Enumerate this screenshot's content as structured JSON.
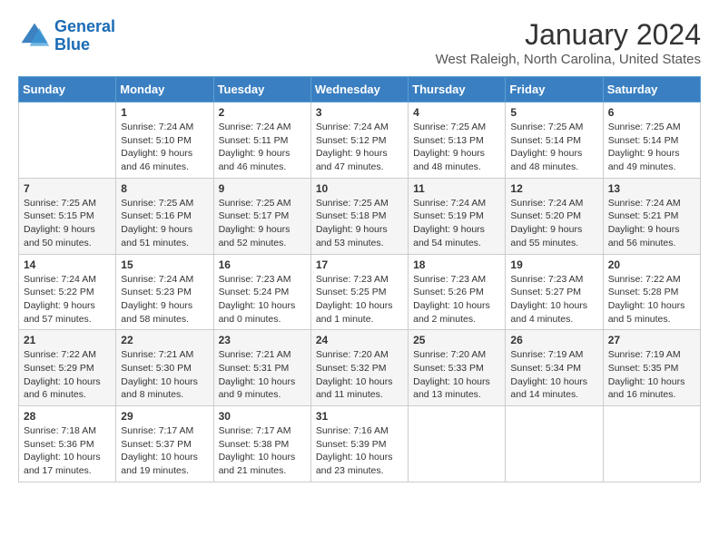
{
  "logo": {
    "text_general": "General",
    "text_blue": "Blue"
  },
  "title": "January 2024",
  "subtitle": "West Raleigh, North Carolina, United States",
  "days_of_week": [
    "Sunday",
    "Monday",
    "Tuesday",
    "Wednesday",
    "Thursday",
    "Friday",
    "Saturday"
  ],
  "weeks": [
    [
      {
        "day": "",
        "sunrise": "",
        "sunset": "",
        "daylight": ""
      },
      {
        "day": "1",
        "sunrise": "Sunrise: 7:24 AM",
        "sunset": "Sunset: 5:10 PM",
        "daylight": "Daylight: 9 hours and 46 minutes."
      },
      {
        "day": "2",
        "sunrise": "Sunrise: 7:24 AM",
        "sunset": "Sunset: 5:11 PM",
        "daylight": "Daylight: 9 hours and 46 minutes."
      },
      {
        "day": "3",
        "sunrise": "Sunrise: 7:24 AM",
        "sunset": "Sunset: 5:12 PM",
        "daylight": "Daylight: 9 hours and 47 minutes."
      },
      {
        "day": "4",
        "sunrise": "Sunrise: 7:25 AM",
        "sunset": "Sunset: 5:13 PM",
        "daylight": "Daylight: 9 hours and 48 minutes."
      },
      {
        "day": "5",
        "sunrise": "Sunrise: 7:25 AM",
        "sunset": "Sunset: 5:14 PM",
        "daylight": "Daylight: 9 hours and 48 minutes."
      },
      {
        "day": "6",
        "sunrise": "Sunrise: 7:25 AM",
        "sunset": "Sunset: 5:14 PM",
        "daylight": "Daylight: 9 hours and 49 minutes."
      }
    ],
    [
      {
        "day": "7",
        "sunrise": "Sunrise: 7:25 AM",
        "sunset": "Sunset: 5:15 PM",
        "daylight": "Daylight: 9 hours and 50 minutes."
      },
      {
        "day": "8",
        "sunrise": "Sunrise: 7:25 AM",
        "sunset": "Sunset: 5:16 PM",
        "daylight": "Daylight: 9 hours and 51 minutes."
      },
      {
        "day": "9",
        "sunrise": "Sunrise: 7:25 AM",
        "sunset": "Sunset: 5:17 PM",
        "daylight": "Daylight: 9 hours and 52 minutes."
      },
      {
        "day": "10",
        "sunrise": "Sunrise: 7:25 AM",
        "sunset": "Sunset: 5:18 PM",
        "daylight": "Daylight: 9 hours and 53 minutes."
      },
      {
        "day": "11",
        "sunrise": "Sunrise: 7:24 AM",
        "sunset": "Sunset: 5:19 PM",
        "daylight": "Daylight: 9 hours and 54 minutes."
      },
      {
        "day": "12",
        "sunrise": "Sunrise: 7:24 AM",
        "sunset": "Sunset: 5:20 PM",
        "daylight": "Daylight: 9 hours and 55 minutes."
      },
      {
        "day": "13",
        "sunrise": "Sunrise: 7:24 AM",
        "sunset": "Sunset: 5:21 PM",
        "daylight": "Daylight: 9 hours and 56 minutes."
      }
    ],
    [
      {
        "day": "14",
        "sunrise": "Sunrise: 7:24 AM",
        "sunset": "Sunset: 5:22 PM",
        "daylight": "Daylight: 9 hours and 57 minutes."
      },
      {
        "day": "15",
        "sunrise": "Sunrise: 7:24 AM",
        "sunset": "Sunset: 5:23 PM",
        "daylight": "Daylight: 9 hours and 58 minutes."
      },
      {
        "day": "16",
        "sunrise": "Sunrise: 7:23 AM",
        "sunset": "Sunset: 5:24 PM",
        "daylight": "Daylight: 10 hours and 0 minutes."
      },
      {
        "day": "17",
        "sunrise": "Sunrise: 7:23 AM",
        "sunset": "Sunset: 5:25 PM",
        "daylight": "Daylight: 10 hours and 1 minute."
      },
      {
        "day": "18",
        "sunrise": "Sunrise: 7:23 AM",
        "sunset": "Sunset: 5:26 PM",
        "daylight": "Daylight: 10 hours and 2 minutes."
      },
      {
        "day": "19",
        "sunrise": "Sunrise: 7:23 AM",
        "sunset": "Sunset: 5:27 PM",
        "daylight": "Daylight: 10 hours and 4 minutes."
      },
      {
        "day": "20",
        "sunrise": "Sunrise: 7:22 AM",
        "sunset": "Sunset: 5:28 PM",
        "daylight": "Daylight: 10 hours and 5 minutes."
      }
    ],
    [
      {
        "day": "21",
        "sunrise": "Sunrise: 7:22 AM",
        "sunset": "Sunset: 5:29 PM",
        "daylight": "Daylight: 10 hours and 6 minutes."
      },
      {
        "day": "22",
        "sunrise": "Sunrise: 7:21 AM",
        "sunset": "Sunset: 5:30 PM",
        "daylight": "Daylight: 10 hours and 8 minutes."
      },
      {
        "day": "23",
        "sunrise": "Sunrise: 7:21 AM",
        "sunset": "Sunset: 5:31 PM",
        "daylight": "Daylight: 10 hours and 9 minutes."
      },
      {
        "day": "24",
        "sunrise": "Sunrise: 7:20 AM",
        "sunset": "Sunset: 5:32 PM",
        "daylight": "Daylight: 10 hours and 11 minutes."
      },
      {
        "day": "25",
        "sunrise": "Sunrise: 7:20 AM",
        "sunset": "Sunset: 5:33 PM",
        "daylight": "Daylight: 10 hours and 13 minutes."
      },
      {
        "day": "26",
        "sunrise": "Sunrise: 7:19 AM",
        "sunset": "Sunset: 5:34 PM",
        "daylight": "Daylight: 10 hours and 14 minutes."
      },
      {
        "day": "27",
        "sunrise": "Sunrise: 7:19 AM",
        "sunset": "Sunset: 5:35 PM",
        "daylight": "Daylight: 10 hours and 16 minutes."
      }
    ],
    [
      {
        "day": "28",
        "sunrise": "Sunrise: 7:18 AM",
        "sunset": "Sunset: 5:36 PM",
        "daylight": "Daylight: 10 hours and 17 minutes."
      },
      {
        "day": "29",
        "sunrise": "Sunrise: 7:17 AM",
        "sunset": "Sunset: 5:37 PM",
        "daylight": "Daylight: 10 hours and 19 minutes."
      },
      {
        "day": "30",
        "sunrise": "Sunrise: 7:17 AM",
        "sunset": "Sunset: 5:38 PM",
        "daylight": "Daylight: 10 hours and 21 minutes."
      },
      {
        "day": "31",
        "sunrise": "Sunrise: 7:16 AM",
        "sunset": "Sunset: 5:39 PM",
        "daylight": "Daylight: 10 hours and 23 minutes."
      },
      {
        "day": "",
        "sunrise": "",
        "sunset": "",
        "daylight": ""
      },
      {
        "day": "",
        "sunrise": "",
        "sunset": "",
        "daylight": ""
      },
      {
        "day": "",
        "sunrise": "",
        "sunset": "",
        "daylight": ""
      }
    ]
  ]
}
